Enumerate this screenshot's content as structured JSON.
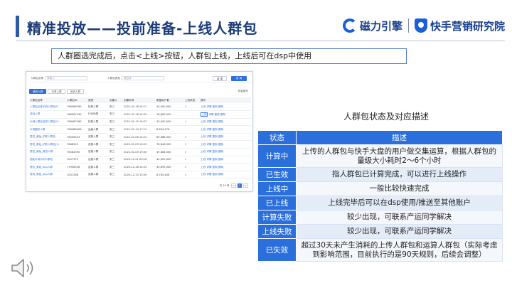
{
  "slide": {
    "title": "精准投放——投前准备-上线人群包",
    "brand_left": "磁力引擎",
    "brand_right": "快手营销研究院",
    "description": "人群圈选完成后，点击<上线>按钮，人群包上线，上线后可在dsp中使用"
  },
  "screenshot": {
    "filter_label_1": "人群包名称",
    "filter_placeholder_1": "请输入",
    "filter_label_2": "人群包类型",
    "filter_placeholder_2": "请选择",
    "reset_label": "重 置",
    "query_label": "查 询",
    "tabs": [
      {
        "label": "我的人群"
      },
      {
        "label": "分享人群"
      },
      {
        "label": "系统人群"
      }
    ],
    "export_label": "批量操作",
    "columns": [
      "人群包名称",
      "人群包ID",
      "类型",
      "创建人",
      "创建时间",
      "覆盖用户数",
      "上线状态",
      "操作"
    ],
    "rows": [
      {
        "name": "人群包名称示例人群包01",
        "id": "766486789",
        "type": "标签人群",
        "creator": "张三",
        "created": "2021-01-18 15:21",
        "count": "43,000,000",
        "state": "√",
        "ops": "上线 详情 复制 删除"
      },
      {
        "name": "游戏人群",
        "id": "766487230",
        "type": "行业标签",
        "creator": "张三",
        "created": "2021-01-18 14:33",
        "count": "18,683,000",
        "state": "",
        "ops": "上线 详情 复制 删除"
      },
      {
        "name": "示例人群包名称人群包03",
        "id": "766487560",
        "type": "标签人群",
        "creator": "张三",
        "created": "2021-01-15 19:07",
        "count": "43,000,000",
        "state": "√",
        "ops": "上线 详情 复制 删除"
      },
      {
        "name": "示例图形人群",
        "id": "766486408",
        "type": "运营人群",
        "creator": "张三",
        "created": "2021-01-14 17:12",
        "count": "8,893,476",
        "state": "",
        "ops": "上线 详情 复制 删除"
      },
      {
        "name": "男性_美妆_护肤人群包",
        "id": "76556323",
        "type": "定制人群",
        "creator": "张三",
        "created": "2021-01-06 14:24",
        "count": "60,688,000",
        "state": "√",
        "ops": "上线 详情 复制 删除"
      },
      {
        "name": "男性_美妆_护肤人群包(2)",
        "id": "7666520",
        "type": "定制人群",
        "creator": "张三",
        "created": "2021-01-05 10:03",
        "count": "76,846,000",
        "state": "√",
        "ops": "上线 详情 复制 删除"
      },
      {
        "name": "男性_美妆_美容人群",
        "id": "76562390",
        "type": "定制人群",
        "creator": "张三",
        "created": "2021-01-05 19:30",
        "count": "35,684,000",
        "state": "√",
        "ops": "上线 详情 复制 删除"
      },
      {
        "name": "国民手游示例人群包",
        "id": "1057374",
        "type": "运营人群",
        "creator": "张三",
        "created": "2020-12-21 09:16",
        "count": "43,000,000",
        "state": "√",
        "ops": "上线 详情 复制 删除"
      },
      {
        "name": "男性_美妆_app人群",
        "id": "77956556",
        "type": "定制人群",
        "creator": "张三",
        "created": "2020-12-18 14:53",
        "count": "30,895,000",
        "state": "√",
        "ops": "上线 详情 复制 删除"
      },
      {
        "name": "游戏_美妆_app人群",
        "id": "1057268",
        "type": "定制人群",
        "creator": "张三",
        "created": "2020-12-15 15:39",
        "count": "8,785,406",
        "state": "√",
        "ops": "上线 详情 复制 删除"
      }
    ],
    "pager": {
      "total_text": "共 10 条",
      "pages": [
        "<",
        "1",
        ">"
      ]
    }
  },
  "status_table": {
    "title": "人群包状态及对应描述",
    "header_status": "状态",
    "header_desc": "描述",
    "rows": [
      {
        "status": "计算中",
        "desc": "上传的人群包与快手大盘的用户做交集运算，根据人群包的量级大小耗时2～6个小时"
      },
      {
        "status": "已生效",
        "desc": "指人群包已计算完成，可以进行上线操作"
      },
      {
        "status": "上线中",
        "desc": "一般比较快速完成"
      },
      {
        "status": "已上线",
        "desc": "上线完毕后可以在dsp使用/推送至其他账户"
      },
      {
        "status": "计算失败",
        "desc": "较少出现，可联系产运同学解决"
      },
      {
        "status": "上线失败",
        "desc": "较少出现，可联系产运同学解决"
      },
      {
        "status": "已失效",
        "desc": "超过30天未产生消耗的上传人群包和运算人群包（实际考虑到影响范围，目前执行的是90天规则，后续会调整）"
      }
    ]
  },
  "icons": {
    "speaker": "speaker-icon",
    "brand_left_logo": "magnet-c-logo-icon",
    "brand_right_logo": "shield-logo-icon"
  }
}
